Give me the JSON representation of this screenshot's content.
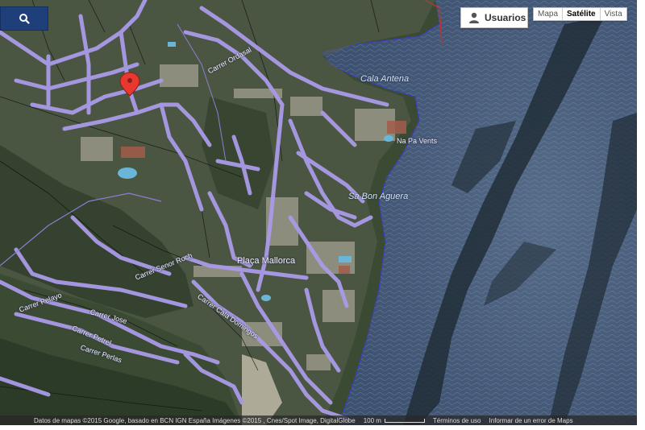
{
  "toolbar": {
    "search_icon": "search-icon",
    "users_label": "Usuarios",
    "users_icon": "user-icon",
    "map_types": [
      {
        "label": "Mapa",
        "active": false
      },
      {
        "label": "Satélite",
        "active": true
      },
      {
        "label": "Vista",
        "active": false
      }
    ]
  },
  "labels": {
    "carrer_ordasal": "Carrer Ordasal",
    "cala_antena": "Cala Antena",
    "na_vents": "Na Pa Vents",
    "sa_bon_aguera": "Sa Bon Aguera",
    "placa_mallorca": "Plaça Mallorca",
    "carrer_cala_domingos": "Carrer Cala Domingos",
    "carrer_senor_roch": "Carrer Senor Roch",
    "carrer_pelayo": "Carrer Pelayo",
    "carrer_pel_jose": "Carrer Jose",
    "carrer_perlas": "Carrer Perlas",
    "carrer_petrel": "Carrer Petrel"
  },
  "attribution": {
    "data": "Datos de mapas ©2015 Google, basado en BCN IGN España Imágenes ©2015 , Cnes/Spot Image, DigitalGlobe",
    "scale": "100 m",
    "terms": "Términos de uso",
    "report": "Informar de un error de Maps"
  },
  "colors": {
    "road_overlay": "#a99ae8",
    "coast_line": "#3a3ad0",
    "marker": "#e8382f",
    "button_blue": "#1f3f7a"
  }
}
